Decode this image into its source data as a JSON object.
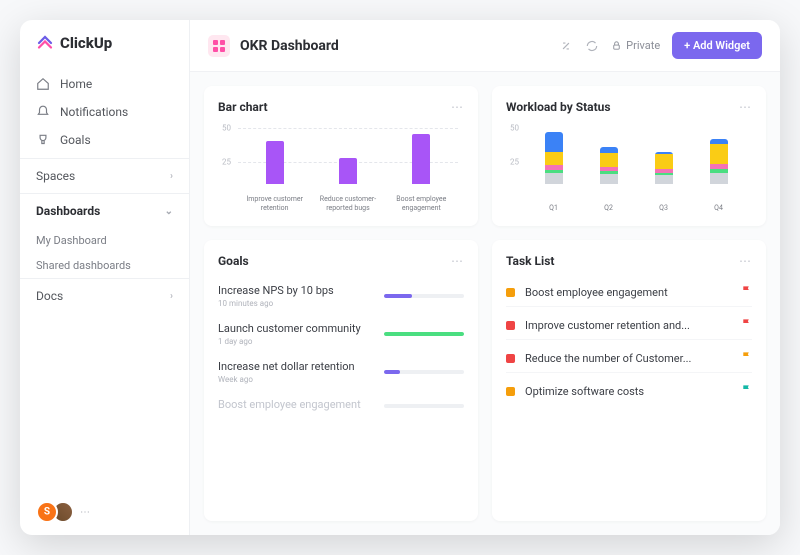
{
  "brand": "ClickUp",
  "sidebar": {
    "nav": [
      {
        "icon": "home",
        "label": "Home"
      },
      {
        "icon": "bell",
        "label": "Notifications"
      },
      {
        "icon": "trophy",
        "label": "Goals"
      }
    ],
    "sections": [
      {
        "label": "Spaces",
        "expanded": false
      },
      {
        "label": "Dashboards",
        "expanded": true,
        "items": [
          "My Dashboard",
          "Shared dashboards"
        ]
      },
      {
        "label": "Docs",
        "expanded": false
      }
    ]
  },
  "header": {
    "title": "OKR Dashboard",
    "private_label": "Private",
    "add_widget_label": "+ Add Widget"
  },
  "cards": {
    "bar_chart": {
      "title": "Bar chart"
    },
    "workload": {
      "title": "Workload by Status"
    },
    "goals": {
      "title": "Goals",
      "items": [
        {
          "name": "Increase NPS by 10 bps",
          "time": "10 minutes ago",
          "progress": 35,
          "color": "#7b68ee"
        },
        {
          "name": "Launch customer community",
          "time": "1 day ago",
          "progress": 100,
          "color": "#4ade80"
        },
        {
          "name": "Increase net dollar retention",
          "time": "Week ago",
          "progress": 20,
          "color": "#7b68ee"
        },
        {
          "name": "Boost employee engagement",
          "time": "",
          "progress": 0,
          "color": "#e5e7eb",
          "faded": true
        }
      ]
    },
    "tasks": {
      "title": "Task List",
      "items": [
        {
          "color": "#f59e0b",
          "name": "Boost employee engagement",
          "flag": "#ef4444"
        },
        {
          "color": "#ef4444",
          "name": "Improve customer retention and...",
          "flag": "#ef4444"
        },
        {
          "color": "#ef4444",
          "name": "Reduce the number of Customer...",
          "flag": "#f59e0b"
        },
        {
          "color": "#f59e0b",
          "name": "Optimize software costs",
          "flag": "#14b8a6"
        }
      ]
    }
  },
  "chart_data": [
    {
      "type": "bar",
      "title": "Bar chart",
      "categories": [
        "Improve customer retention",
        "Reduce customer-reported bugs",
        "Boost employee engagement"
      ],
      "values": [
        40,
        24,
        46
      ],
      "ylim": [
        0,
        50
      ],
      "ticks": [
        25,
        50
      ],
      "color": "#a855f7"
    },
    {
      "type": "stacked_bar",
      "title": "Workload by Status",
      "categories": [
        "Q1",
        "Q2",
        "Q3",
        "Q4"
      ],
      "ylim": [
        0,
        50
      ],
      "ticks": [
        25,
        50
      ],
      "series": [
        {
          "name": "grey",
          "color": "#d1d5db",
          "values": [
            10,
            9,
            8,
            10
          ]
        },
        {
          "name": "green",
          "color": "#4ade80",
          "values": [
            3,
            3,
            2,
            4
          ]
        },
        {
          "name": "pink",
          "color": "#f472b6",
          "values": [
            5,
            4,
            4,
            5
          ]
        },
        {
          "name": "yellow",
          "color": "#facc15",
          "values": [
            12,
            13,
            14,
            18
          ]
        },
        {
          "name": "blue",
          "color": "#3b82f6",
          "values": [
            18,
            5,
            2,
            5
          ]
        }
      ]
    }
  ]
}
